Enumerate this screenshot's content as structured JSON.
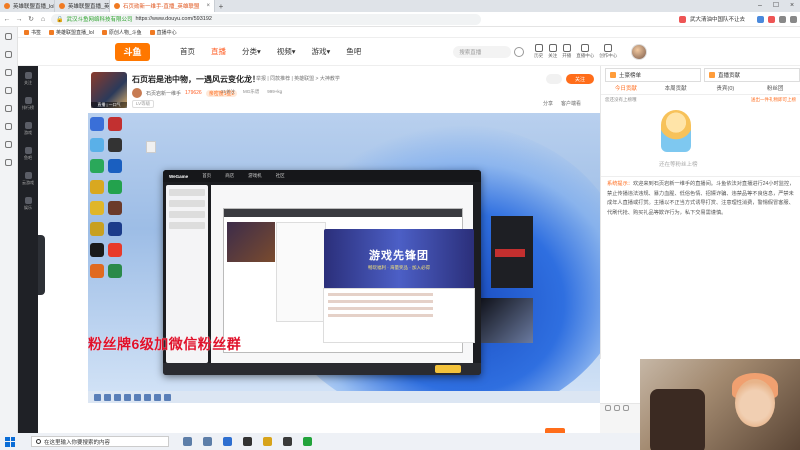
{
  "browser": {
    "tabs": [
      {
        "label": "英雄联盟直播_lol直播"
      },
      {
        "label": "英雄联盟直播_英雄联盟直播"
      },
      {
        "label": "石页勋新一维手-直播_英雄联盟",
        "active": true
      }
    ],
    "url_org": "武汉斗鱼网络科技有限公司",
    "url": "https://www.douyu.com/593192",
    "ext_text": "武大清油中国队不让去",
    "bookmarks": [
      "书签",
      "英雄联盟直播_lol",
      "原创人物_斗鱼",
      "直播中心"
    ]
  },
  "douyu": {
    "logo": "斗鱼",
    "nav": [
      "首页",
      "直播",
      "分类▾",
      "视频▾",
      "游戏▾",
      "鱼吧"
    ],
    "nav_active_index": 1,
    "search_placeholder": "搜索直播",
    "tools": [
      "历史",
      "关注",
      "开播",
      "直播中心",
      "创作中心"
    ],
    "sidebar": [
      "关注",
      "排行榜",
      "游戏",
      "鱼吧",
      "云游戏",
      "娱乐",
      "更多"
    ]
  },
  "room": {
    "thumb_caption": "直播 | 一口气",
    "title": "石页岩是池中物，一遇风云变化龙！",
    "tags": "举报 | 同款推荐 | 英雄联盟 > 大神教学",
    "streamer": "石页岩新一维手",
    "hot": "179626",
    "pill": "亲密度1星2",
    "meta": [
      "21关注",
      "MG乐谱",
      "999+kg"
    ],
    "level_badge": "LV等级",
    "follow_label": "关注",
    "share_label": "分享",
    "client_label": "客户端看"
  },
  "player": {
    "overlay_text": "粉丝牌6级加微信粉丝群",
    "wegame": {
      "logo": "WeGame",
      "tabs": [
        "首页",
        "商店",
        "游戏机",
        "社区"
      ],
      "banner_big": "游戏先锋团",
      "banner_small": "畅玩福利 · 海量奖品 · 加入必得"
    }
  },
  "panel": {
    "box1": "土豪榜单",
    "box2": "直播贡献",
    "tabs": [
      "今日贡献",
      "本周贡献",
      "贵宾(0)",
      "粉丝团"
    ],
    "active_tab": 0,
    "sub_left": "您还没有上榜哦",
    "sub_right": "送出一件礼物即可上榜",
    "mascot_text": "还在等粉丝上榜",
    "sys_label": "系统提示：",
    "sys_text": "欢迎来到石页岩新一维手的直播间。斗鱼依法对直播进行24小时监控，禁止传播违法违规、暴力血腥、低俗色情、招嫖诈骗、违禁品等不良信息，严禁未成年人直播或打赏。主播以不正当方式诱导打赏、注意理性消费，警惕假冒客服、代刷代抢、购买礼品等欺诈行为，私下交易需谨慎。"
  },
  "taskbar": {
    "search_placeholder": "在这里输入你要搜索的内容"
  }
}
